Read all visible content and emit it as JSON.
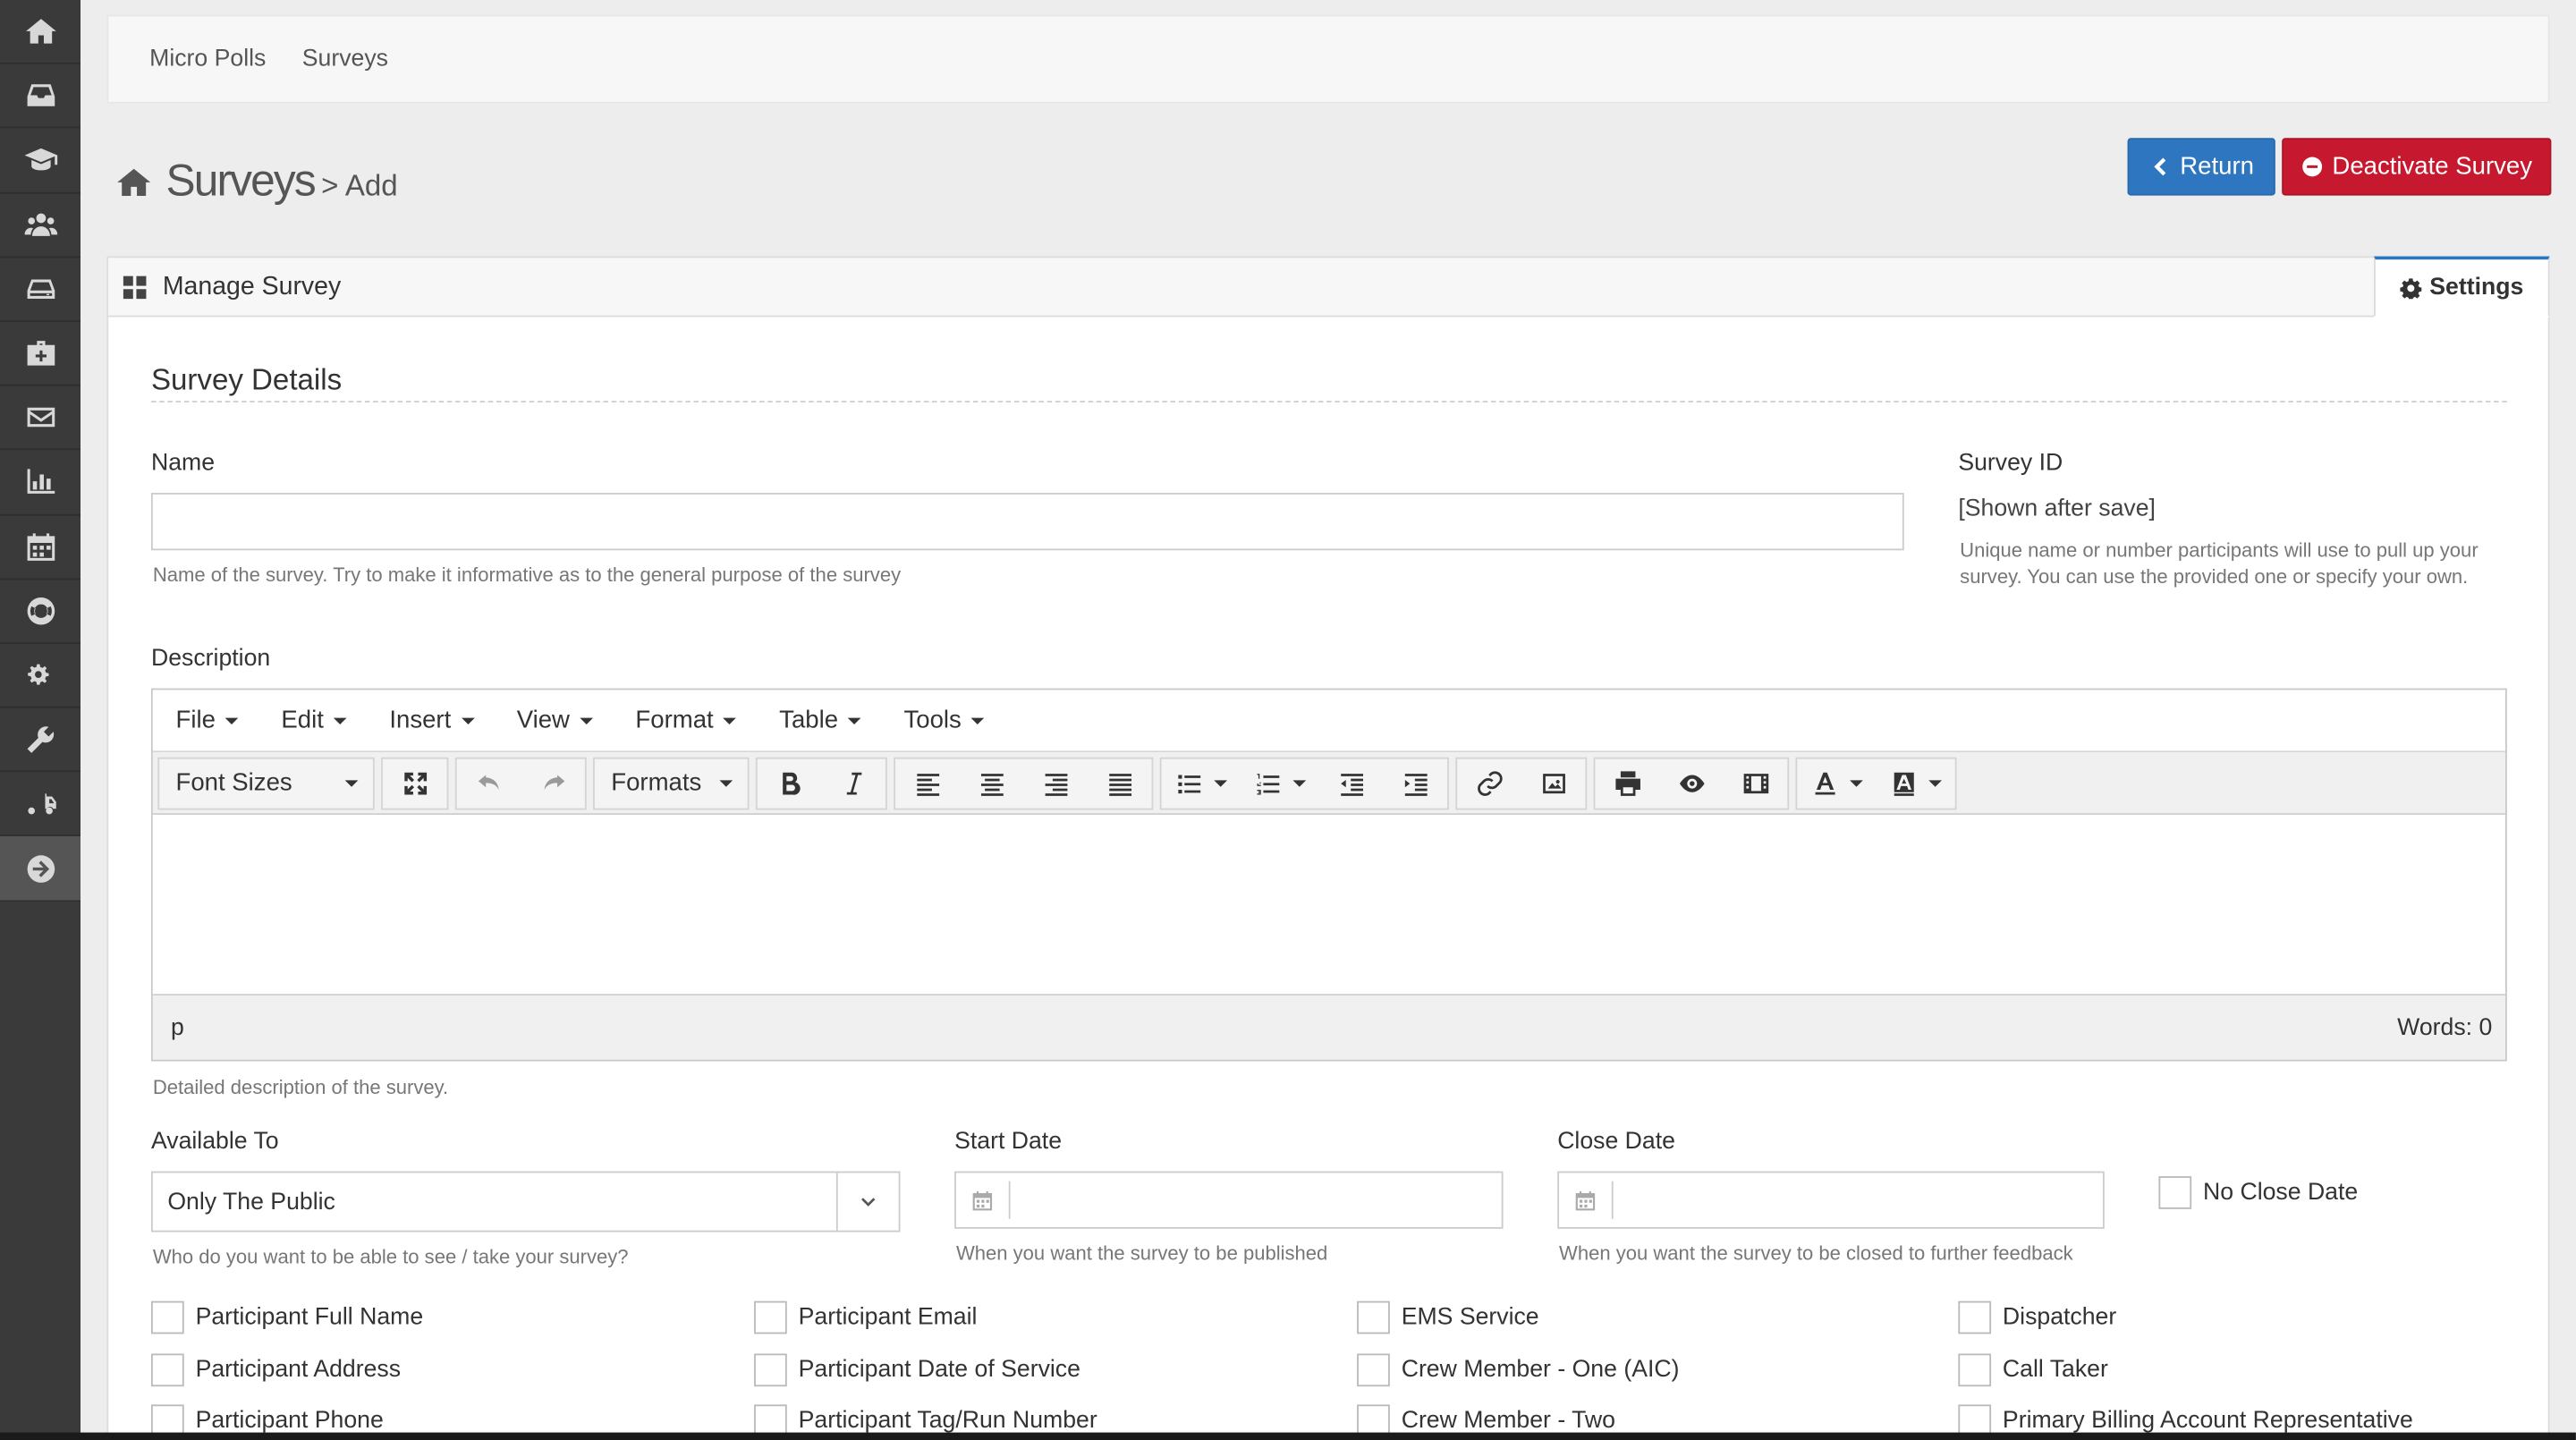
{
  "sidebar": {
    "icons": [
      "home-icon",
      "inbox-icon",
      "graduation-cap-icon",
      "users-icon",
      "hdd-icon",
      "medkit-icon",
      "envelope-icon",
      "bar-chart-icon",
      "calendar-icon",
      "life-ring-icon",
      "cogs-icon",
      "wrench-icon",
      "truck-icon",
      "arrow-circle-right-icon"
    ]
  },
  "breadcrumb": {
    "items": [
      "Micro Polls",
      "Surveys"
    ]
  },
  "header": {
    "title": "Surveys",
    "subtitle": "> Add",
    "return_label": "Return",
    "deactivate_label": "Deactivate Survey"
  },
  "panel": {
    "title": "Manage Survey",
    "settings_label": "Settings"
  },
  "form": {
    "section_title": "Survey Details",
    "name_label": "Name",
    "name_value": "",
    "name_help": "Name of the survey. Try to make it informative as to the general purpose of the survey",
    "survey_id_label": "Survey ID",
    "survey_id_value": "[Shown after save]",
    "survey_id_help": "Unique name or number participants will use to pull up your survey. You can use the provided one or specify your own.",
    "description_label": "Description",
    "description_help": "Detailed description of the survey.",
    "available_to_label": "Available To",
    "available_to_value": "Only The Public",
    "available_to_help": "Who do you want to be able to see / take your survey?",
    "start_date_label": "Start Date",
    "start_date_value": "",
    "start_date_help": "When you want the survey to be published",
    "close_date_label": "Close Date",
    "close_date_value": "",
    "close_date_help": "When you want the survey to be closed to further feedback",
    "no_close_date_label": "No Close Date"
  },
  "editor": {
    "menu": [
      "File",
      "Edit",
      "Insert",
      "View",
      "Format",
      "Table",
      "Tools"
    ],
    "font_sizes_label": "Font Sizes",
    "formats_label": "Formats",
    "status_path": "p",
    "word_count": "Words: 0"
  },
  "checkboxes": {
    "col1": [
      "Participant Full Name",
      "Participant Address",
      "Participant Phone"
    ],
    "col2": [
      "Participant Email",
      "Participant Date of Service",
      "Participant Tag/Run Number"
    ],
    "col3": [
      "EMS Service",
      "Crew Member - One (AIC)",
      "Crew Member - Two"
    ],
    "col4": [
      "Dispatcher",
      "Call Taker",
      "Primary Billing Account Representative"
    ]
  },
  "colors": {
    "primary": "#2e77c0",
    "danger": "#c6182f",
    "sidebar": "#3a3a3a"
  }
}
